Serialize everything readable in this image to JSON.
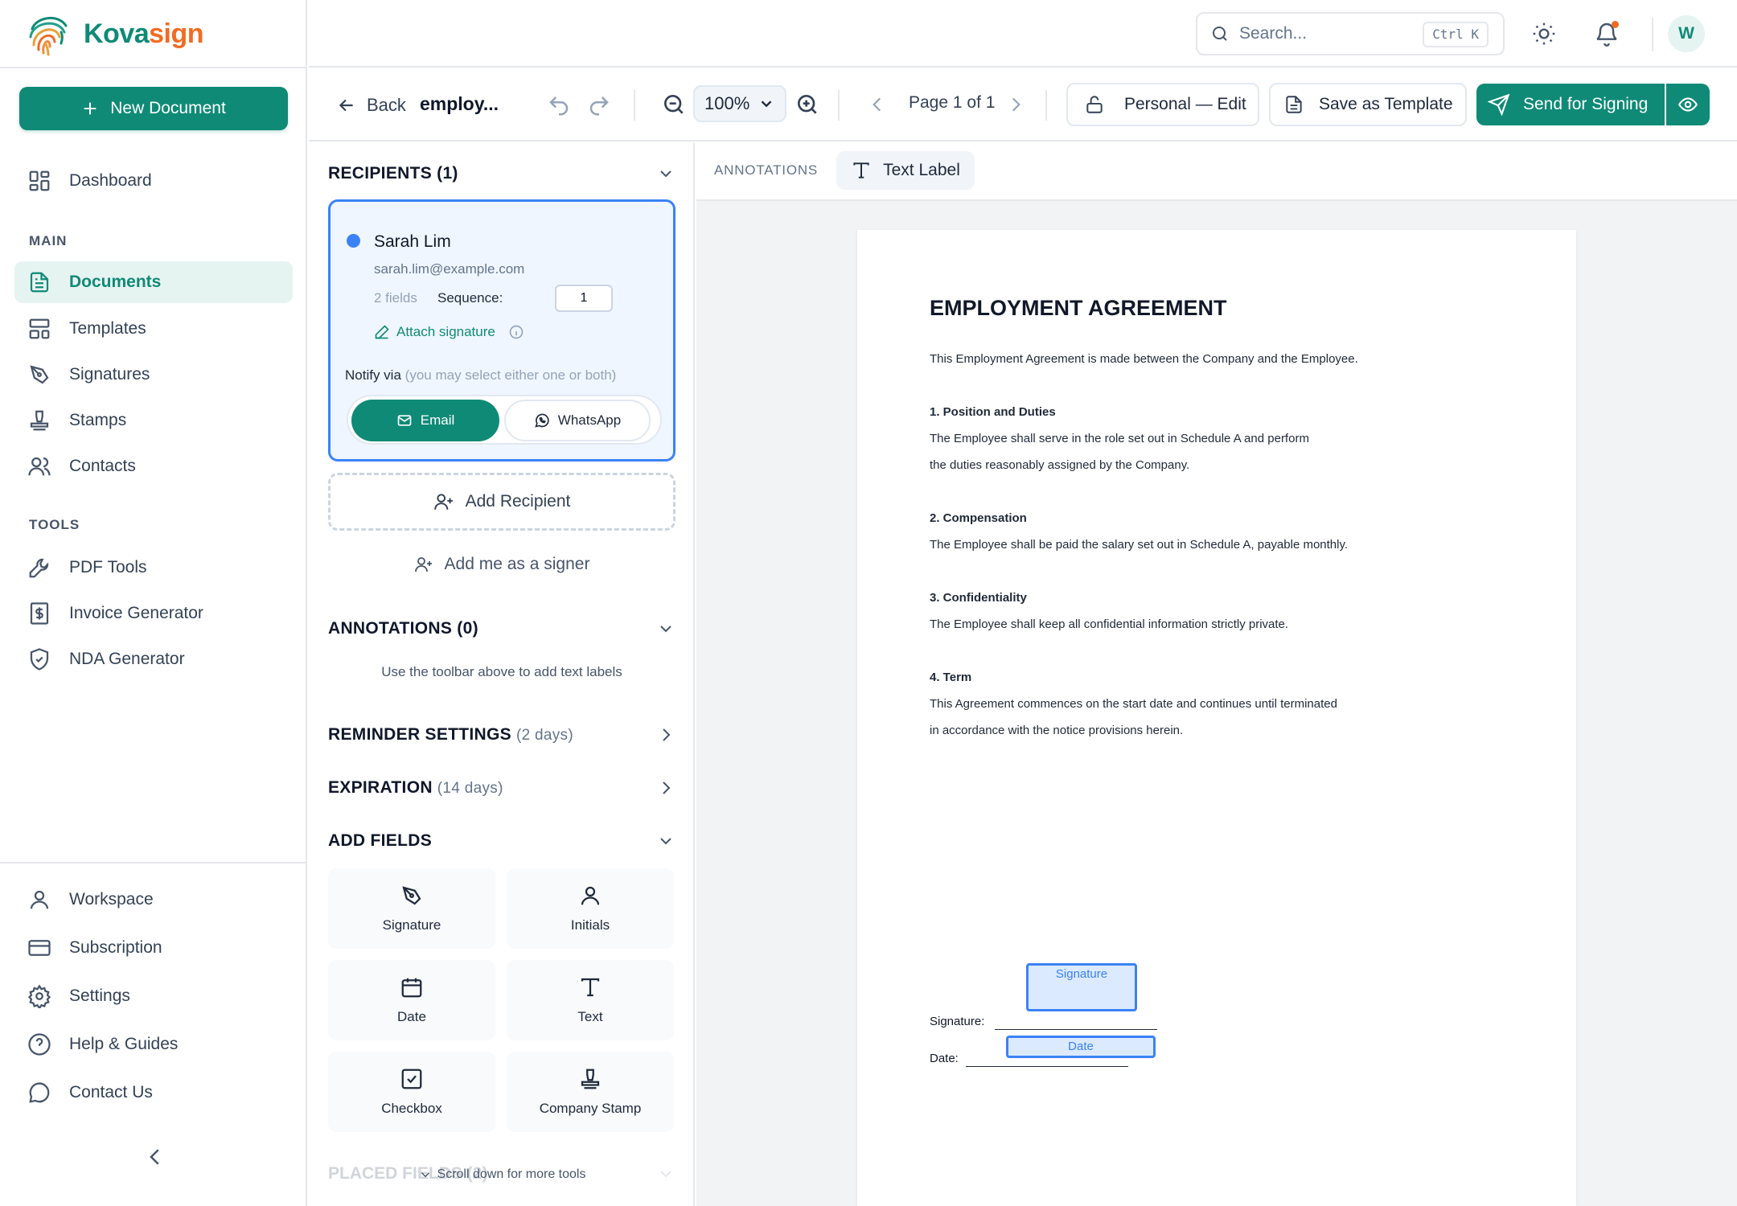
{
  "brand": {
    "name_part1": "Kova",
    "name_part2": "sign",
    "teal": "#0f8a76",
    "orange": "#f26b22"
  },
  "sidebar": {
    "new_document_label": "New Document",
    "dashboard_label": "Dashboard",
    "main_section": "MAIN",
    "main_items": [
      {
        "label": "Documents",
        "icon": "file-text-icon",
        "active": true
      },
      {
        "label": "Templates",
        "icon": "layout-icon"
      },
      {
        "label": "Signatures",
        "icon": "pen-nib-icon"
      },
      {
        "label": "Stamps",
        "icon": "stamp-icon"
      },
      {
        "label": "Contacts",
        "icon": "users-icon"
      }
    ],
    "tools_section": "TOOLS",
    "tool_items": [
      {
        "label": "PDF Tools",
        "icon": "wrench-icon"
      },
      {
        "label": "Invoice Generator",
        "icon": "invoice-icon"
      },
      {
        "label": "NDA Generator",
        "icon": "shield-icon"
      }
    ],
    "bottom_items": [
      {
        "label": "Workspace",
        "icon": "user-icon"
      },
      {
        "label": "Subscription",
        "icon": "credit-card-icon"
      },
      {
        "label": "Settings",
        "icon": "gear-icon"
      },
      {
        "label": "Help & Guides",
        "icon": "help-circle-icon"
      },
      {
        "label": "Contact Us",
        "icon": "message-circle-icon"
      }
    ]
  },
  "topbar": {
    "search_placeholder": "Search...",
    "shortcut": "Ctrl K",
    "avatar_initial": "W"
  },
  "toolbar": {
    "back_label": "Back",
    "doc_title": "employ...",
    "zoom": "100%",
    "page_indicator": "Page 1 of 1",
    "permission_label": "Personal — Edit",
    "save_template_label": "Save as Template",
    "send_label": "Send for Signing"
  },
  "panel": {
    "recipients_title": "RECIPIENTS (1)",
    "recipient": {
      "name": "Sarah Lim",
      "email": "sarah.lim@example.com",
      "fields": "2 fields",
      "sequence_label": "Sequence:",
      "sequence": "1",
      "attach_label": "Attach signature",
      "notify_label": "Notify via",
      "notify_hint": "(you may select either one or both)",
      "email_option": "Email",
      "whatsapp_option": "WhatsApp",
      "status_color": "#3b82f6"
    },
    "add_recipient_label": "Add Recipient",
    "add_me_label": "Add me as a signer",
    "annotations_title": "ANNOTATIONS (0)",
    "annotations_hint": "Use the toolbar above to add text labels",
    "reminder_title": "REMINDER SETTINGS",
    "reminder_value": "(2 days)",
    "expiration_title": "EXPIRATION",
    "expiration_value": "(14 days)",
    "add_fields_title": "ADD FIELDS",
    "fields": [
      {
        "label": "Signature",
        "icon": "pen-nib-icon"
      },
      {
        "label": "Initials",
        "icon": "user-icon"
      },
      {
        "label": "Date",
        "icon": "calendar-icon"
      },
      {
        "label": "Text",
        "icon": "type-icon"
      },
      {
        "label": "Checkbox",
        "icon": "checkbox-icon"
      },
      {
        "label": "Company Stamp",
        "icon": "stamp-icon"
      }
    ],
    "placed_title": "PLACED FIELDS (2)",
    "scroll_hint": "Scroll down for more tools"
  },
  "canvas": {
    "annotations_label": "ANNOTATIONS",
    "text_label_btn": "Text Label",
    "document": {
      "heading": "EMPLOYMENT AGREEMENT",
      "intro": "This Employment Agreement is made between the Company and the Employee.",
      "s1_title": "1. Position and Duties",
      "s1_l1": "The Employee shall serve in the role set out in Schedule A and perform",
      "s1_l2": "the duties reasonably assigned by the Company.",
      "s2_title": "2. Compensation",
      "s2_l1": "The Employee shall be paid the salary set out in Schedule A, payable monthly.",
      "s3_title": "3. Confidentiality",
      "s3_l1": "The Employee shall keep all confidential information strictly private.",
      "s4_title": "4. Term",
      "s4_l1": "This Agreement commences on the start date and continues until terminated",
      "s4_l2": "in accordance with the notice provisions herein.",
      "signature_label": "Signature:",
      "date_label": "Date:",
      "signature_field": "Signature",
      "date_field": "Date"
    }
  }
}
